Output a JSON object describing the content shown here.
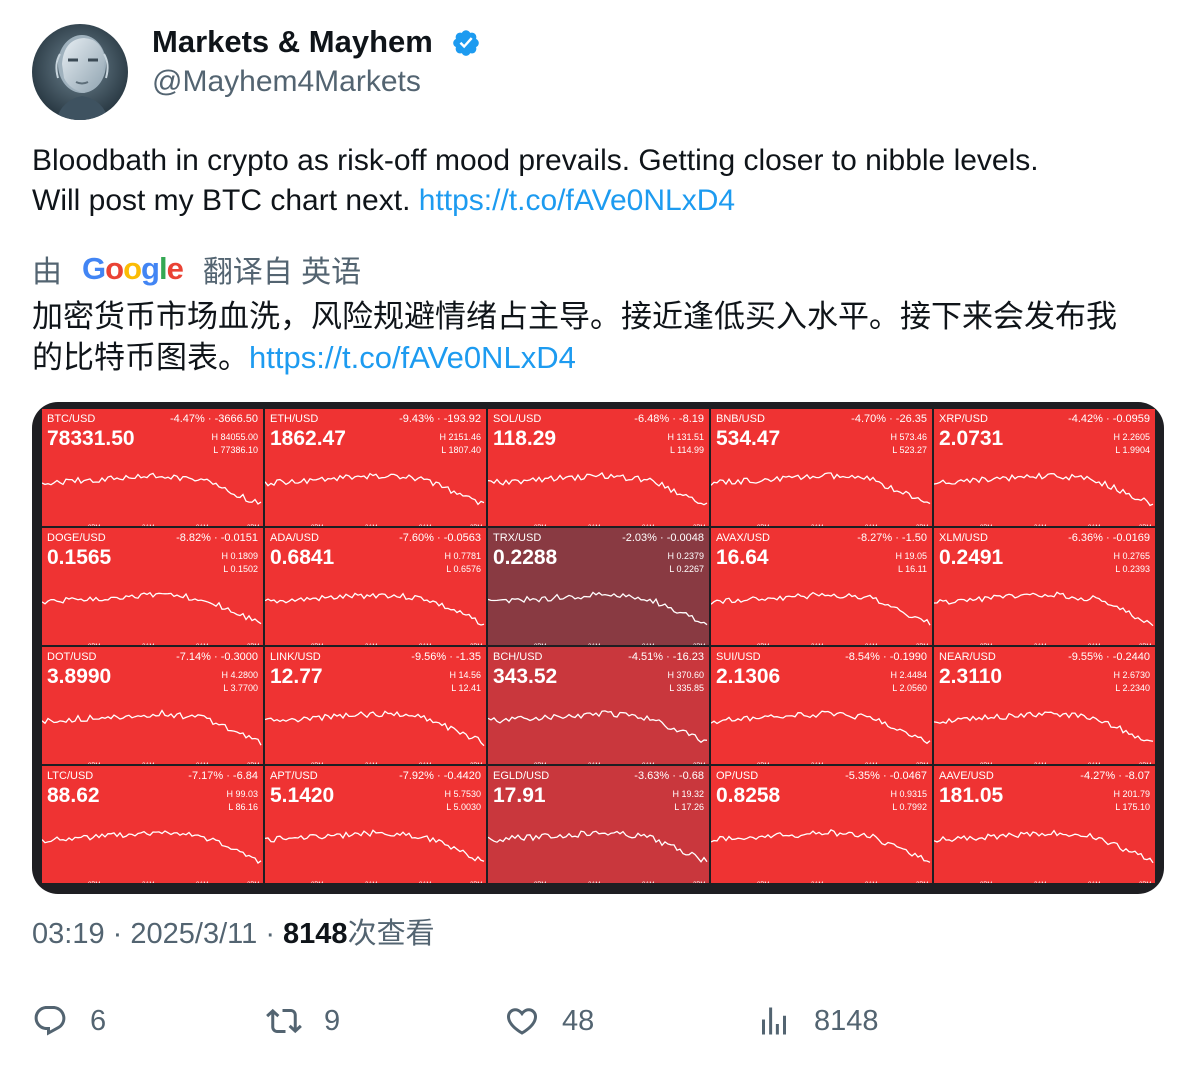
{
  "author": {
    "name": "Markets & Mayhem",
    "handle": "@Mayhem4Markets",
    "verified_icon": "verified-badge-icon",
    "avatar_icon": "robot-avatar-icon"
  },
  "tweet": {
    "line1": "Bloodbath in crypto as risk-off mood prevails. Getting closer to nibble levels.",
    "line2": "Will post my BTC chart next.",
    "link": "https://t.co/fAVe0NLxD4"
  },
  "translation": {
    "by": "由",
    "provider": "Google",
    "label": "翻译自 英语",
    "line1": "加密货币市场血洗，风险规避情绪占主导。接近逢低买入水平。接下来会发布我",
    "line2": "的比特币图表。",
    "link": "https://t.co/fAVe0NLxD4"
  },
  "media": {
    "axis_labels": [
      "8PM",
      "2AM",
      "8AM",
      "2PM"
    ],
    "tiles": [
      {
        "symbol": "BTC/USD",
        "change": "-4.47% · -3666.50",
        "price": "78331.50",
        "high": "H 84055.00",
        "low": "L 77386.10",
        "shade": "red"
      },
      {
        "symbol": "ETH/USD",
        "change": "-9.43% · -193.92",
        "price": "1862.47",
        "high": "H 2151.46",
        "low": "L 1807.40",
        "shade": "red"
      },
      {
        "symbol": "SOL/USD",
        "change": "-6.48% · -8.19",
        "price": "118.29",
        "high": "H 131.51",
        "low": "L 114.99",
        "shade": "red"
      },
      {
        "symbol": "BNB/USD",
        "change": "-4.70% · -26.35",
        "price": "534.47",
        "high": "H 573.46",
        "low": "L 523.27",
        "shade": "red"
      },
      {
        "symbol": "XRP/USD",
        "change": "-4.42% · -0.0959",
        "price": "2.0731",
        "high": "H 2.2605",
        "low": "L 1.9904",
        "shade": "red"
      },
      {
        "symbol": "DOGE/USD",
        "change": "-8.82% · -0.0151",
        "price": "0.1565",
        "high": "H 0.1809",
        "low": "L 0.1502",
        "shade": "red"
      },
      {
        "symbol": "ADA/USD",
        "change": "-7.60% · -0.0563",
        "price": "0.6841",
        "high": "H 0.7781",
        "low": "L 0.6576",
        "shade": "red"
      },
      {
        "symbol": "TRX/USD",
        "change": "-2.03% · -0.0048",
        "price": "0.2288",
        "high": "H 0.2379",
        "low": "L 0.2267",
        "shade": "dark"
      },
      {
        "symbol": "AVAX/USD",
        "change": "-8.27% · -1.50",
        "price": "16.64",
        "high": "H 19.05",
        "low": "L 16.11",
        "shade": "red"
      },
      {
        "symbol": "XLM/USD",
        "change": "-6.36% · -0.0169",
        "price": "0.2491",
        "high": "H 0.2765",
        "low": "L 0.2393",
        "shade": "red"
      },
      {
        "symbol": "DOT/USD",
        "change": "-7.14% · -0.3000",
        "price": "3.8990",
        "high": "H 4.2800",
        "low": "L 3.7700",
        "shade": "red"
      },
      {
        "symbol": "LINK/USD",
        "change": "-9.56% · -1.35",
        "price": "12.77",
        "high": "H 14.56",
        "low": "L 12.41",
        "shade": "red"
      },
      {
        "symbol": "BCH/USD",
        "change": "-4.51% · -16.23",
        "price": "343.52",
        "high": "H 370.60",
        "low": "L 335.85",
        "shade": "mid"
      },
      {
        "symbol": "SUI/USD",
        "change": "-8.54% · -0.1990",
        "price": "2.1306",
        "high": "H 2.4484",
        "low": "L 2.0560",
        "shade": "red"
      },
      {
        "symbol": "NEAR/USD",
        "change": "-9.55% · -0.2440",
        "price": "2.3110",
        "high": "H 2.6730",
        "low": "L 2.2340",
        "shade": "red"
      },
      {
        "symbol": "LTC/USD",
        "change": "-7.17% · -6.84",
        "price": "88.62",
        "high": "H 99.03",
        "low": "L 86.16",
        "shade": "red"
      },
      {
        "symbol": "APT/USD",
        "change": "-7.92% · -0.4420",
        "price": "5.1420",
        "high": "H 5.7530",
        "low": "L 5.0030",
        "shade": "red"
      },
      {
        "symbol": "EGLD/USD",
        "change": "-3.63% · -0.68",
        "price": "17.91",
        "high": "H 19.32",
        "low": "L 17.26",
        "shade": "mid"
      },
      {
        "symbol": "OP/USD",
        "change": "-5.35% · -0.0467",
        "price": "0.8258",
        "high": "H 0.9315",
        "low": "L 0.7992",
        "shade": "red"
      },
      {
        "symbol": "AAVE/USD",
        "change": "-4.27% · -8.07",
        "price": "181.05",
        "high": "H 201.79",
        "low": "L 175.10",
        "shade": "red"
      }
    ]
  },
  "meta": {
    "time": "03:19",
    "separator": "·",
    "date": "2025/3/11",
    "views": "8148",
    "views_label": "次查看"
  },
  "actions": {
    "replies": "6",
    "reposts": "9",
    "likes": "48",
    "views": "8148"
  }
}
